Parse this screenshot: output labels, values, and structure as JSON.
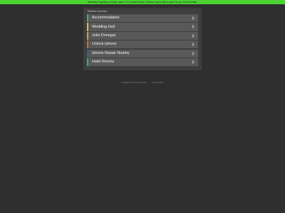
{
  "topbar": {
    "text": "Interested in getting a domain name? Our Domain Broker Service may be able to get it for you. Find out here.",
    "color": "#4cd233"
  },
  "panel": {
    "title": "Related searches",
    "items": [
      {
        "label": "Accommodation",
        "accent": "#2eb67d"
      },
      {
        "label": "Wedding Hall",
        "accent": "#e0c022"
      },
      {
        "label": "Jobs Donegal",
        "accent": "#d4a21c"
      },
      {
        "label": "Unlock Iphone",
        "accent": "#d9671c"
      },
      {
        "label": "Iphone Repair Nearby",
        "accent": "#2f5fa8"
      },
      {
        "label": "Hotel Rooms",
        "accent": "#2eb67d"
      }
    ],
    "chevron_icon": "chevron-right-icon"
  },
  "footer": {
    "copyright": "Copyright © All rights reserved.",
    "privacy": "Privacy Policy"
  }
}
